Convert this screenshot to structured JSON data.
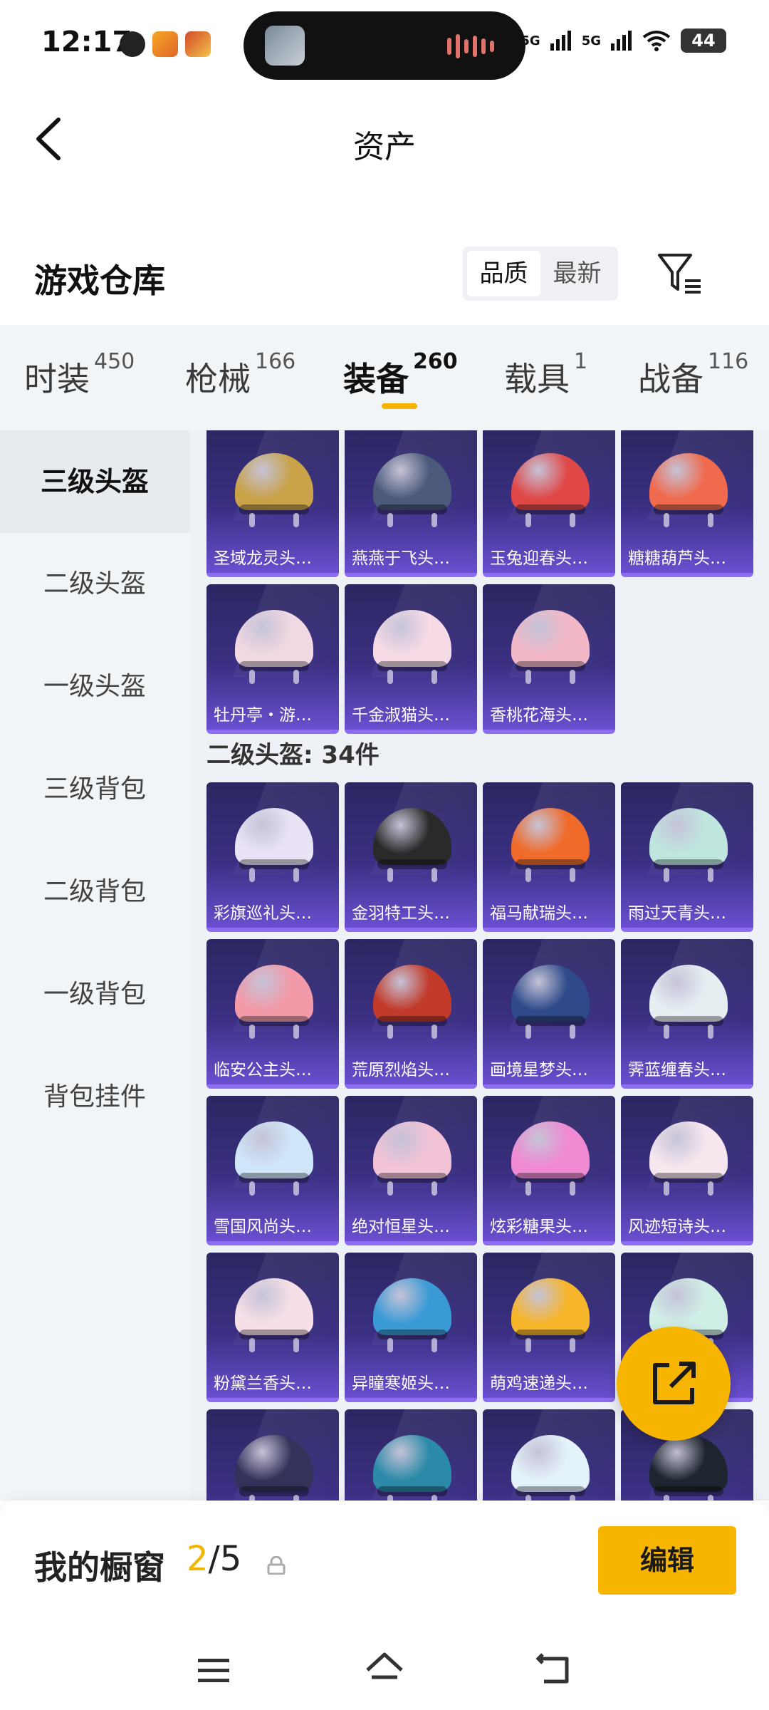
{
  "status_bar": {
    "time": "12:17",
    "signal1": "5G",
    "signal2": "5G",
    "battery": "44"
  },
  "header": {
    "title": "资产"
  },
  "warehouse": {
    "title": "游戏仓库",
    "sort_options": [
      "品质",
      "最新"
    ],
    "sort_selected": "品质"
  },
  "tabs": [
    {
      "label": "时装",
      "count": "450"
    },
    {
      "label": "枪械",
      "count": "166"
    },
    {
      "label": "装备",
      "count": "260",
      "active": true
    },
    {
      "label": "载具",
      "count": "1"
    },
    {
      "label": "战备",
      "count": "116"
    }
  ],
  "sidebar": {
    "items": [
      {
        "label": "三级头盔",
        "active": true
      },
      {
        "label": "二级头盔"
      },
      {
        "label": "一级头盔"
      },
      {
        "label": "三级背包"
      },
      {
        "label": "二级背包"
      },
      {
        "label": "一级背包"
      },
      {
        "label": "背包挂件"
      }
    ]
  },
  "grid": {
    "level3_items": [
      {
        "label": "圣域龙灵头…",
        "color": "#c9a24a"
      },
      {
        "label": "燕燕于飞头…",
        "color": "#4b5a7a"
      },
      {
        "label": "玉兔迎春头…",
        "color": "#e04848"
      },
      {
        "label": "糖糖葫芦头…",
        "color": "#f06a4e"
      },
      {
        "label": "牡丹亭・游…",
        "color": "#f1d8e2"
      },
      {
        "label": "千金淑猫头…",
        "color": "#f6dbe6"
      },
      {
        "label": "香桃花海头…",
        "color": "#f3b8c8"
      }
    ],
    "section_title": "二级头盔: 34件",
    "level2_items": [
      {
        "label": "彩旗巡礼头…",
        "color": "#e9e3f5"
      },
      {
        "label": "金羽特工头…",
        "color": "#2a2a2a"
      },
      {
        "label": "福马献瑞头…",
        "color": "#f06a2a"
      },
      {
        "label": "雨过天青头…",
        "color": "#bfe6df"
      },
      {
        "label": "临安公主头…",
        "color": "#f29aa8"
      },
      {
        "label": "荒原烈焰头…",
        "color": "#c23a2a"
      },
      {
        "label": "画境星梦头…",
        "color": "#2e4a8a"
      },
      {
        "label": "霁蓝缠春头…",
        "color": "#e6eef2"
      },
      {
        "label": "雪国风尚头…",
        "color": "#cfe6fa"
      },
      {
        "label": "绝对恒星头…",
        "color": "#f2c2d6"
      },
      {
        "label": "炫彩糖果头…",
        "color": "#f08ad2"
      },
      {
        "label": "风迹短诗头…",
        "color": "#f6e6ee"
      },
      {
        "label": "粉黛兰香头…",
        "color": "#f6dfe6"
      },
      {
        "label": "异瞳寒姬头…",
        "color": "#3a9ad6"
      },
      {
        "label": "萌鸡速递头…",
        "color": "#f7b52a"
      },
      {
        "label": "",
        "color": "#cfeee6"
      },
      {
        "label": "",
        "color": "#34325a"
      },
      {
        "label": "",
        "color": "#2a8aa8"
      },
      {
        "label": "",
        "color": "#e4f2fa"
      },
      {
        "label": "",
        "color": "#1e2530"
      }
    ]
  },
  "showcase": {
    "label": "我的橱窗",
    "current": "2",
    "total": "/5",
    "edit_label": "编辑"
  },
  "colors": {
    "accent": "#f7b500",
    "card_bg": "#3a2f82"
  }
}
